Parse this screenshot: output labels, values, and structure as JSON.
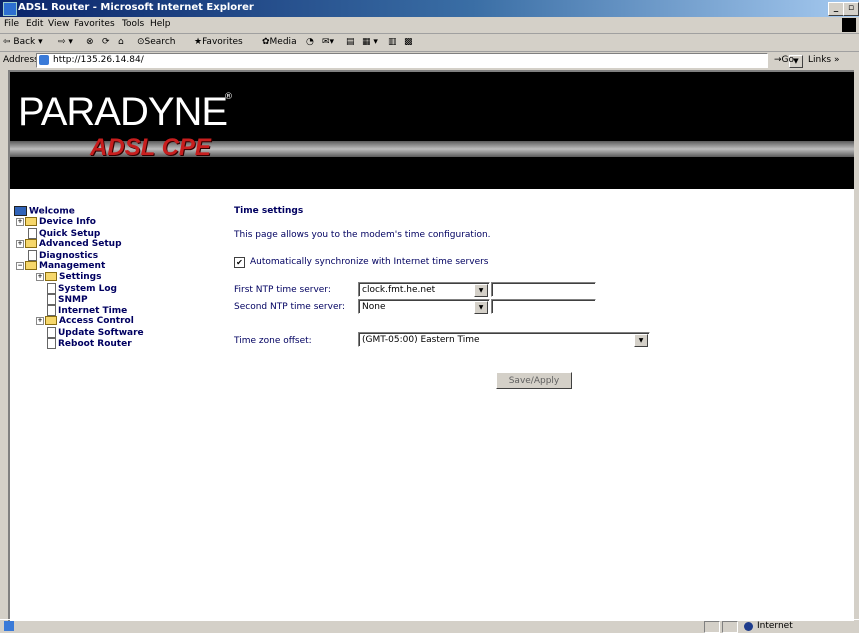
{
  "window": {
    "title": "ADSL Router - Microsoft Internet Explorer"
  },
  "menu": [
    "File",
    "Edit",
    "View",
    "Favorites",
    "Tools",
    "Help"
  ],
  "toolbar": {
    "back": "Back",
    "search": "Search",
    "favorites": "Favorites",
    "media": "Media"
  },
  "address": {
    "label": "Address",
    "url": "http://135.26.14.84/",
    "go": "Go",
    "links": "Links"
  },
  "banner": {
    "brand": "PARADYNE",
    "reg": "®",
    "product": "ADSL CPE"
  },
  "nav": [
    {
      "label": "Welcome"
    },
    {
      "label": "Device Info"
    },
    {
      "label": "Quick Setup"
    },
    {
      "label": "Advanced Setup"
    },
    {
      "label": "Diagnostics"
    },
    {
      "label": "Management"
    },
    {
      "label": "Settings"
    },
    {
      "label": "System Log"
    },
    {
      "label": "SNMP"
    },
    {
      "label": "Internet Time"
    },
    {
      "label": "Access Control"
    },
    {
      "label": "Update Software"
    },
    {
      "label": "Reboot Router"
    }
  ],
  "page": {
    "title": "Time settings",
    "description": "This page allows you to the modem's time configuration.",
    "auto_sync_label": "Automatically synchronize with Internet time servers",
    "auto_sync_checked": true,
    "first_ntp_label": "First NTP time server:",
    "first_ntp_value": "clock.fmt.he.net",
    "second_ntp_label": "Second NTP time server:",
    "second_ntp_value": "None",
    "tz_label": "Time zone offset:",
    "tz_value": "(GMT-05:00) Eastern Time",
    "save_button": "Save/Apply"
  },
  "status": {
    "zone": "Internet"
  }
}
